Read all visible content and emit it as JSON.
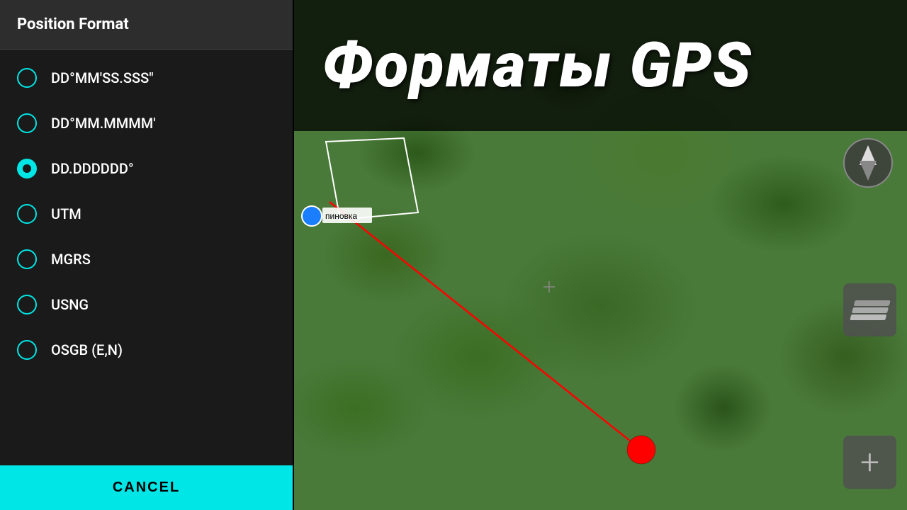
{
  "dialog": {
    "title": "Position Format",
    "options": [
      {
        "id": "dd_mm_ss",
        "label": "DD°MM'SS.SSS\"",
        "selected": false
      },
      {
        "id": "dd_mm_mmmm",
        "label": "DD°MM.MMMM'",
        "selected": false
      },
      {
        "id": "dd_dddddd",
        "label": "DD.DDDDDD°",
        "selected": true
      },
      {
        "id": "utm",
        "label": "UTM",
        "selected": false
      },
      {
        "id": "mgrs",
        "label": "MGRS",
        "selected": false
      },
      {
        "id": "usng",
        "label": "USNG",
        "selected": false
      },
      {
        "id": "osgb",
        "label": "OSGB (E,N)",
        "selected": false
      }
    ],
    "cancel_label": "CANCEL"
  },
  "map": {
    "title": "Форматы GPS",
    "location_label": "пиновка"
  }
}
